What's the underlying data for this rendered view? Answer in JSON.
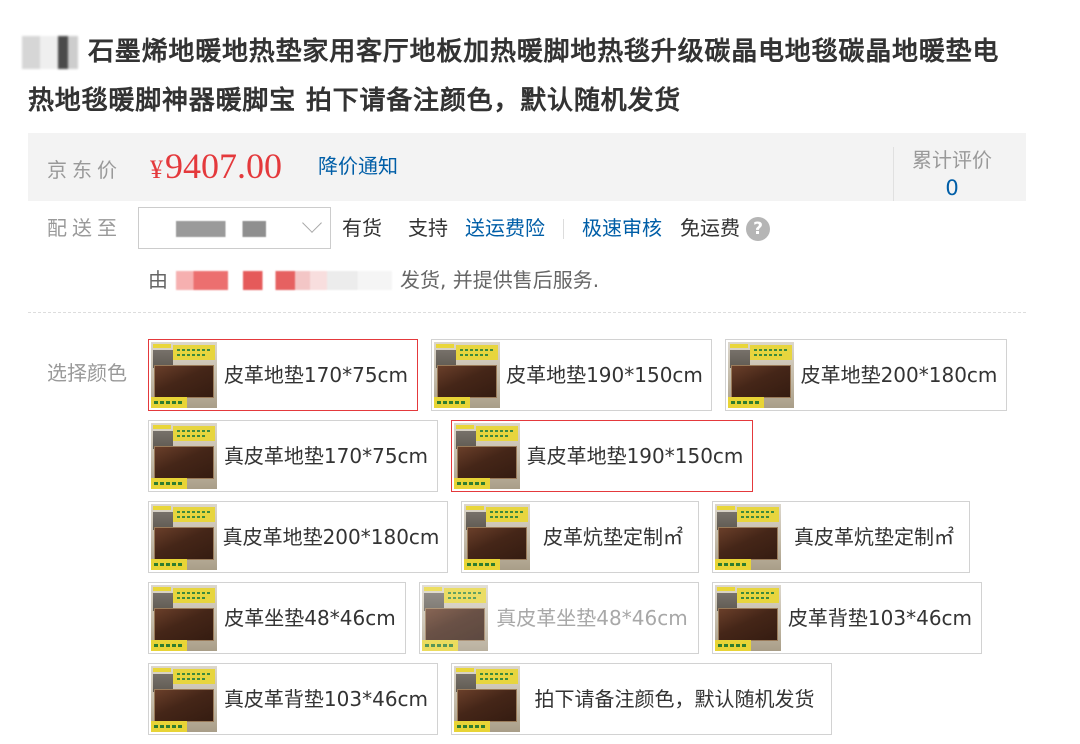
{
  "title": {
    "text": "石墨烯地暖地热垫家用客厅地板加热暖脚地热毯升级碳晶电地毯碳晶地暖垫电热地毯暖脚神器暖脚宝 拍下请备注颜色，默认随机发货"
  },
  "price": {
    "label": "京东价",
    "currency": "¥",
    "amount": "9407.00",
    "notify_link": "降价通知"
  },
  "reviews": {
    "label": "累计评价",
    "count": "0"
  },
  "delivery": {
    "label": "配送至",
    "dropdown_icon": "chevron-down-icon",
    "stock_status": "有货",
    "support_label": "支持",
    "freight_insurance_link": "送运费险",
    "fast_review_link": "极速审核",
    "free_shipping": "免运费",
    "help_icon": "help-icon"
  },
  "seller": {
    "prefix": "由",
    "suffix": "发货, 并提供售后服务."
  },
  "color_select": {
    "label": "选择颜色",
    "options": [
      {
        "label": "皮革地垫170*75cm",
        "selected": true
      },
      {
        "label": "皮革地垫190*150cm"
      },
      {
        "label": "皮革地垫200*180cm"
      },
      {
        "label": "真皮革地垫170*75cm"
      },
      {
        "label": "真皮革地垫190*150cm",
        "selected": true
      },
      {
        "label": "真皮革地垫200*180cm"
      },
      {
        "label": "皮革炕垫定制㎡"
      },
      {
        "label": "真皮革炕垫定制㎡"
      },
      {
        "label": "皮革坐垫48*46cm"
      },
      {
        "label": "真皮革坐垫48*46cm",
        "disabled": true
      },
      {
        "label": "皮革背垫103*46cm"
      },
      {
        "label": "真皮革背垫103*46cm"
      },
      {
        "label": "拍下请备注颜色，默认随机发货"
      }
    ]
  },
  "colors": {
    "price_red": "#e4393c",
    "link_blue": "#005ea7",
    "selected_border": "#e4393c"
  }
}
